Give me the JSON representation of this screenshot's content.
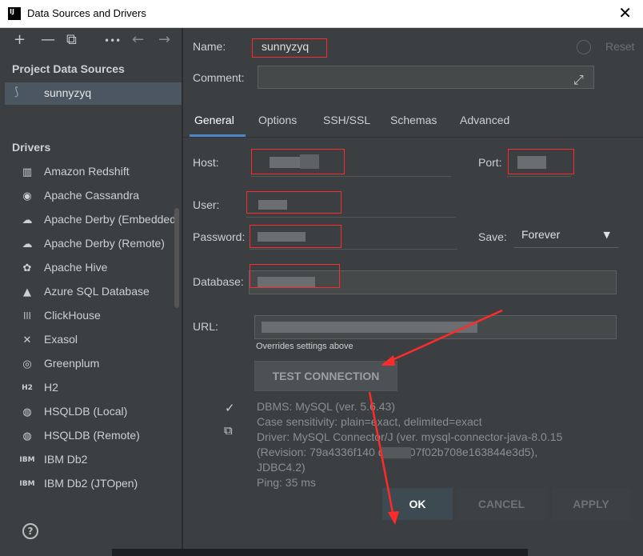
{
  "window": {
    "title": "Data Sources and Drivers",
    "app_icon": "intellij-icon",
    "close_glyph": "✕"
  },
  "toolbar": {
    "add": "+",
    "remove": "—",
    "copy": "⧉",
    "more": "•••",
    "back": "←",
    "forward": "→"
  },
  "project": {
    "heading": "Project Data Sources",
    "items": [
      {
        "label": "sunnyzyq",
        "icon": "mysql-dolphin-icon"
      }
    ]
  },
  "drivers": {
    "heading": "Drivers",
    "items": [
      {
        "label": "Amazon Redshift",
        "icon": "redshift-icon",
        "glyph": "▥"
      },
      {
        "label": "Apache Cassandra",
        "icon": "cassandra-icon",
        "glyph": "◉"
      },
      {
        "label": "Apache Derby (Embedded)",
        "icon": "derby-icon",
        "glyph": "☁"
      },
      {
        "label": "Apache Derby (Remote)",
        "icon": "derby-icon",
        "glyph": "☁"
      },
      {
        "label": "Apache Hive",
        "icon": "hive-icon",
        "glyph": "✿"
      },
      {
        "label": "Azure SQL Database",
        "icon": "azure-icon",
        "glyph": "▲"
      },
      {
        "label": "ClickHouse",
        "icon": "clickhouse-icon",
        "glyph": "|||"
      },
      {
        "label": "Exasol",
        "icon": "exasol-icon",
        "glyph": "✕"
      },
      {
        "label": "Greenplum",
        "icon": "greenplum-icon",
        "glyph": "◎"
      },
      {
        "label": "H2",
        "icon": "h2-icon",
        "glyph": "H2"
      },
      {
        "label": "HSQLDB (Local)",
        "icon": "hsqldb-icon",
        "glyph": "◍"
      },
      {
        "label": "HSQLDB (Remote)",
        "icon": "hsqldb-icon",
        "glyph": "◍"
      },
      {
        "label": "IBM Db2",
        "icon": "db2-icon",
        "glyph": "IBM"
      },
      {
        "label": "IBM Db2 (JTOpen)",
        "icon": "db2-icon",
        "glyph": "IBM"
      }
    ]
  },
  "help": {
    "glyph": "?"
  },
  "form": {
    "name_label": "Name:",
    "name_value": "sunnyzyq",
    "reset_label": "Reset",
    "comment_label": "Comment:",
    "comment_value": "",
    "tabs": [
      "General",
      "Options",
      "SSH/SSL",
      "Schemas",
      "Advanced"
    ],
    "active_tab": "General",
    "host_label": "Host:",
    "port_label": "Port:",
    "user_label": "User:",
    "password_label": "Password:",
    "save_label": "Save:",
    "save_value": "Forever",
    "database_label": "Database:",
    "url_label": "URL:",
    "overrides_note": "Overrides settings above",
    "test_connection": "TEST CONNECTION"
  },
  "connection_info": {
    "lines": [
      "DBMS: MySQL (ver. 5.6.43)",
      "Case sensitivity: plain=exact, delimited=exact",
      "Driver: MySQL Connector/J (ver. mysql-connector-java-8.0.15",
      "(Revision: 79a4336f140        d22dd07f02b708e163844e3d5),",
      "JDBC4.2)",
      "Ping: 35 ms"
    ]
  },
  "footer": {
    "ok": "OK",
    "cancel": "CANCEL",
    "apply": "APPLY"
  },
  "colors": {
    "accent": "#4a88c7",
    "annotation": "#ff2a2a",
    "panel": "#3c3f41"
  }
}
